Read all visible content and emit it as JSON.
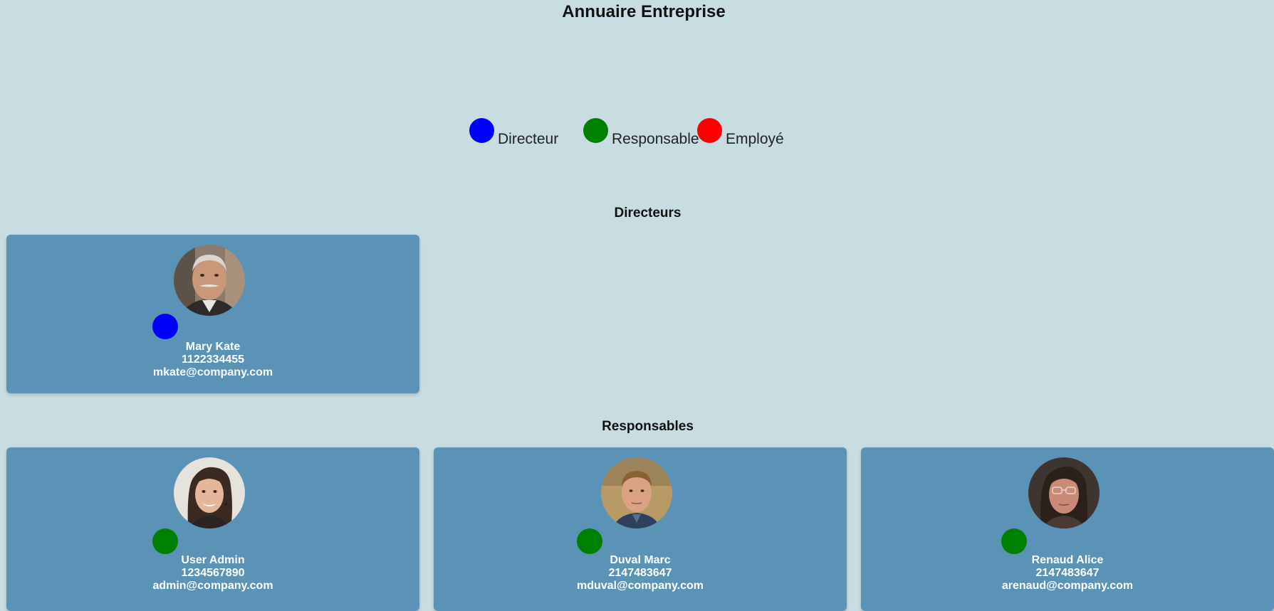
{
  "page": {
    "title": "Annuaire Entreprise"
  },
  "legend": [
    {
      "label": "Directeur",
      "color": "#0000ff"
    },
    {
      "label": "Responsable",
      "color": "#008000"
    },
    {
      "label": "Employé",
      "color": "#ff0000"
    }
  ],
  "sections": {
    "directeurs": {
      "title": "Directeurs",
      "people": [
        {
          "name": "Mary Kate",
          "phone": "1122334455",
          "email": "mkate@company.com",
          "role_color": "#0000ff",
          "avatar": "avatar-older-man"
        }
      ]
    },
    "responsables": {
      "title": "Responsables",
      "people": [
        {
          "name": "User Admin",
          "phone": "1234567890",
          "email": "admin@company.com",
          "role_color": "#008000",
          "avatar": "avatar-woman-dark-hair"
        },
        {
          "name": "Duval Marc",
          "phone": "2147483647",
          "email": "mduval@company.com",
          "role_color": "#008000",
          "avatar": "avatar-man-short-hair"
        },
        {
          "name": "Renaud Alice",
          "phone": "2147483647",
          "email": "arenaud@company.com",
          "role_color": "#008000",
          "avatar": "avatar-older-woman-glasses"
        }
      ]
    }
  },
  "colors": {
    "background": "#c8dde1",
    "card": "#5b93b6",
    "card_text": "#ffffff"
  }
}
